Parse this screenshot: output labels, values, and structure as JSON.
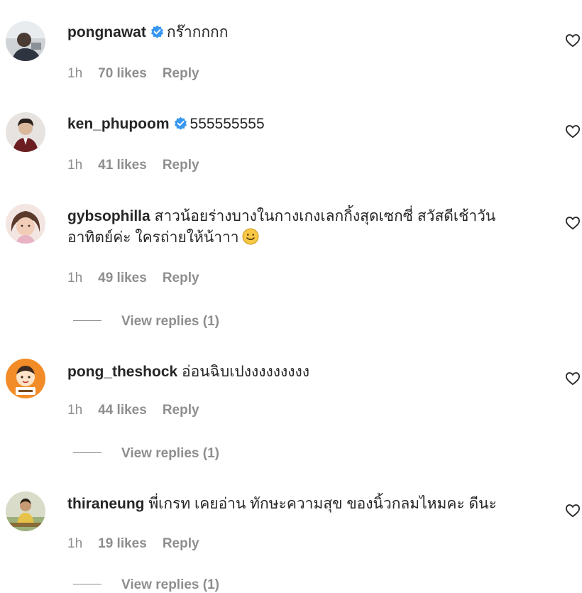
{
  "icons": {
    "verified": "verified-badge-icon",
    "heart": "heart-outline-icon",
    "emoji": "smiling-face-emoji"
  },
  "colors": {
    "verified_blue": "#3897f0",
    "meta_gray": "#8e8e8e",
    "text_dark": "#262626"
  },
  "comments": [
    {
      "username": "pongnawat",
      "verified": true,
      "text": "กร๊ากกกก",
      "time": "1h",
      "likes": "70 likes",
      "reply": "Reply"
    },
    {
      "username": "ken_phupoom",
      "verified": true,
      "text": "555555555",
      "time": "1h",
      "likes": "41 likes",
      "reply": "Reply"
    },
    {
      "username": "gybsophilla",
      "verified": false,
      "text_line1": "สาวน้อยร่างบางในกางเกงเลกกิ้งสุดเซกซี่ สวัสดีเช้าวัน",
      "text_line2": "อาทิตย์ค่ะ ใครถ่ายให้น้าาา",
      "time": "1h",
      "likes": "49 likes",
      "reply": "Reply",
      "view_replies": "View replies (1)"
    },
    {
      "username": "pong_theshock",
      "verified": false,
      "text": "อ่อนฉิบเปงงงงงงงงง",
      "time": "1h",
      "likes": "44 likes",
      "reply": "Reply",
      "view_replies": "View replies (1)"
    },
    {
      "username": "thiraneung",
      "verified": false,
      "text": "พี่เกรท เคยอ่าน ทักษะความสุข ของนิ้วกลมไหมคะ ดีนะ",
      "time": "1h",
      "likes": "19 likes",
      "reply": "Reply",
      "view_replies": "View replies (1)"
    }
  ]
}
